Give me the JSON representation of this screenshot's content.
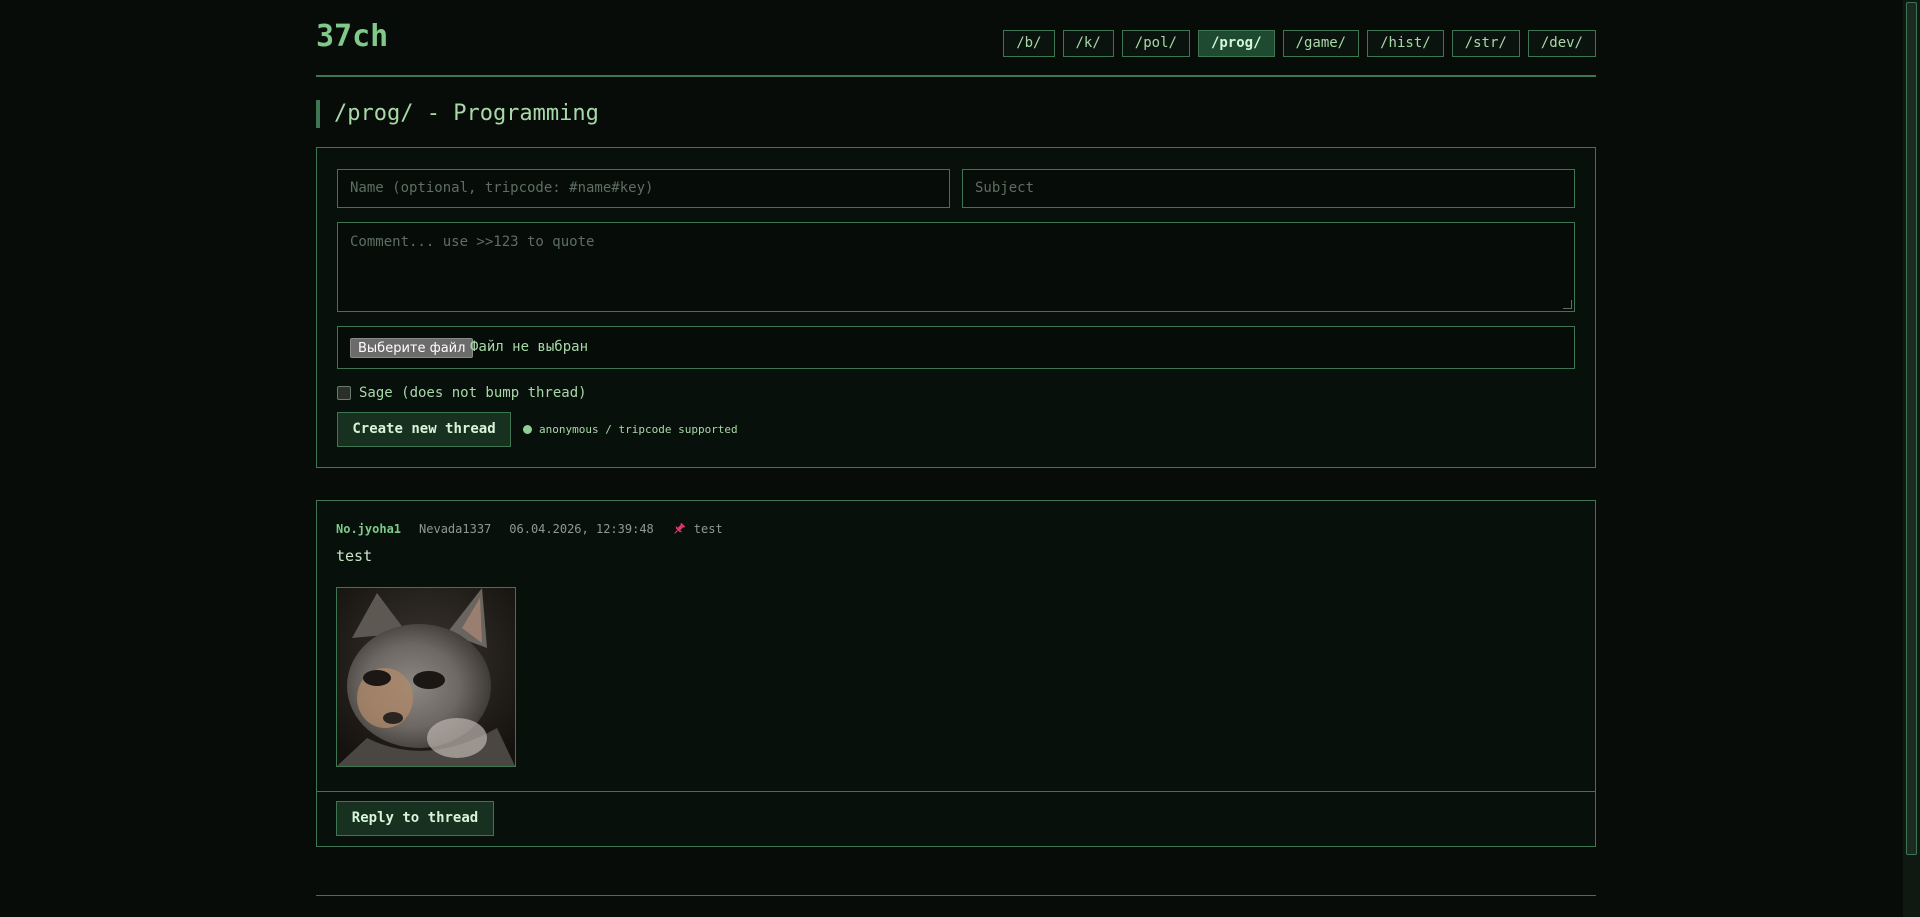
{
  "site": {
    "logo": "37ch"
  },
  "boards": [
    {
      "label": "/b/",
      "active": false
    },
    {
      "label": "/k/",
      "active": false
    },
    {
      "label": "/pol/",
      "active": false
    },
    {
      "label": "/prog/",
      "active": true
    },
    {
      "label": "/game/",
      "active": false
    },
    {
      "label": "/hist/",
      "active": false
    },
    {
      "label": "/str/",
      "active": false
    },
    {
      "label": "/dev/",
      "active": false
    }
  ],
  "board_title": "/prog/ - Programming",
  "form": {
    "name_placeholder": "Name (optional, tripcode: #name#key)",
    "subject_placeholder": "Subject",
    "comment_placeholder": "Comment... use >>123 to quote",
    "file_button": "Выберите файл",
    "file_status": "Файл не выбран",
    "sage_label": "Sage (does not bump thread)",
    "sage_checked": false,
    "submit_label": "Create new thread",
    "hint": "anonymous / tripcode supported"
  },
  "thread": {
    "post_no": "No.jyoha1",
    "author": "Nevada1337",
    "date": "06.04.2026, 12:39:48",
    "pinned": true,
    "subject": "test",
    "body": "test",
    "reply_label": "Reply to thread"
  },
  "colors": {
    "background": "#070c09",
    "accent": "#3e7552",
    "text": "#a8d8a8",
    "pin": "#e0386a"
  }
}
